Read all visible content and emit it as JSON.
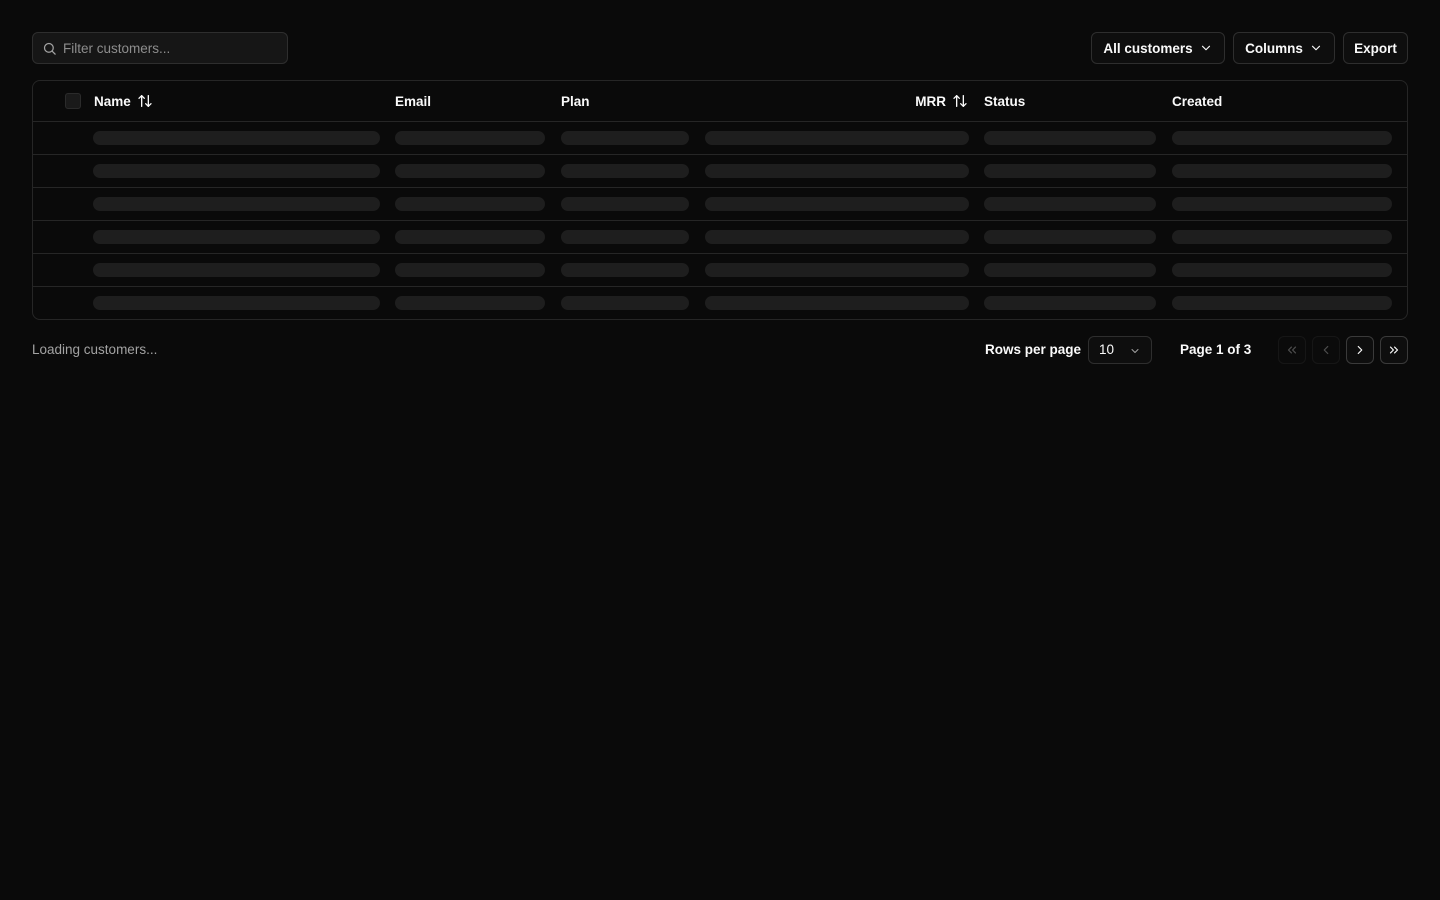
{
  "search": {
    "placeholder": "Filter customers..."
  },
  "toolbar": {
    "filter_label": "All customers",
    "columns_label": "Columns",
    "export_label": "Export"
  },
  "table": {
    "columns": [
      {
        "label": "Name",
        "sortable": true
      },
      {
        "label": "Email",
        "sortable": false
      },
      {
        "label": "Plan",
        "sortable": false
      },
      {
        "label": "MRR",
        "sortable": true
      },
      {
        "label": "Status",
        "sortable": false
      },
      {
        "label": "Created",
        "sortable": false
      }
    ],
    "loading_rows": 6
  },
  "footer": {
    "status_text": "Loading customers...",
    "rows_per_page_label": "Rows per page",
    "rows_per_page_value": "10",
    "page_info": "Page 1 of 3"
  },
  "colors": {
    "background": "#0a0a0a",
    "border": "#262626",
    "skeleton": "#1e1e1e",
    "text": "#fafafa",
    "muted_text": "#a3a3a3"
  },
  "icons": {
    "search": "search-icon",
    "chevron_down": "chevron-down-icon",
    "sort": "sort-arrows-icon",
    "first_page": "chevrons-left-icon",
    "prev_page": "chevron-left-icon",
    "next_page": "chevron-right-icon",
    "last_page": "chevrons-right-icon"
  }
}
